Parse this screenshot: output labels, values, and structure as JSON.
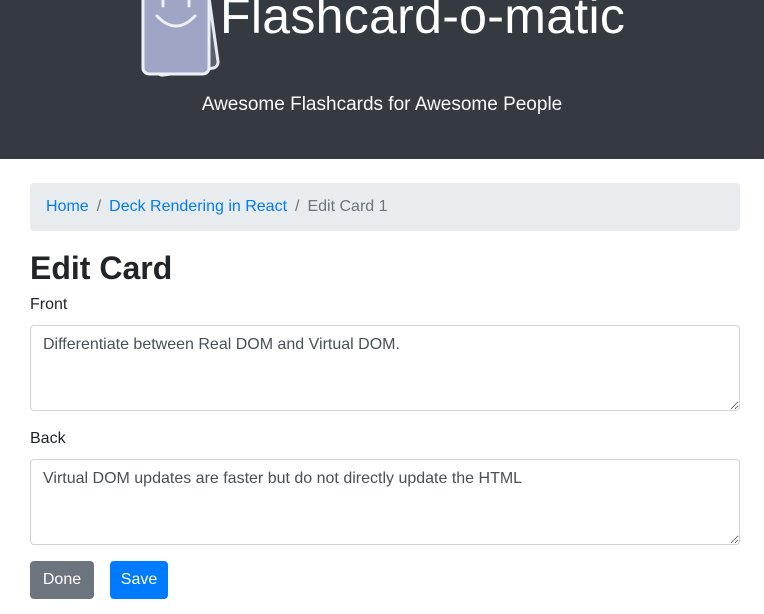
{
  "header": {
    "logo_icon": "smiley-flashcards-icon",
    "title": "Flashcard-o-matic",
    "subtitle": "Awesome Flashcards for Awesome People"
  },
  "breadcrumb": {
    "home": "Home",
    "deck": "Deck Rendering in React",
    "separator": "/",
    "current": "Edit Card 1"
  },
  "page": {
    "title": "Edit Card"
  },
  "form": {
    "front_label": "Front",
    "front_value": "Differentiate between Real DOM and Virtual DOM.",
    "back_label": "Back",
    "back_value": "Virtual DOM updates are faster but do not directly update the HTML"
  },
  "buttons": {
    "done": "Done",
    "save": "Save"
  },
  "colors": {
    "header_bg": "#343a40",
    "link": "#007bff",
    "secondary": "#6c757d",
    "primary": "#007bff"
  }
}
